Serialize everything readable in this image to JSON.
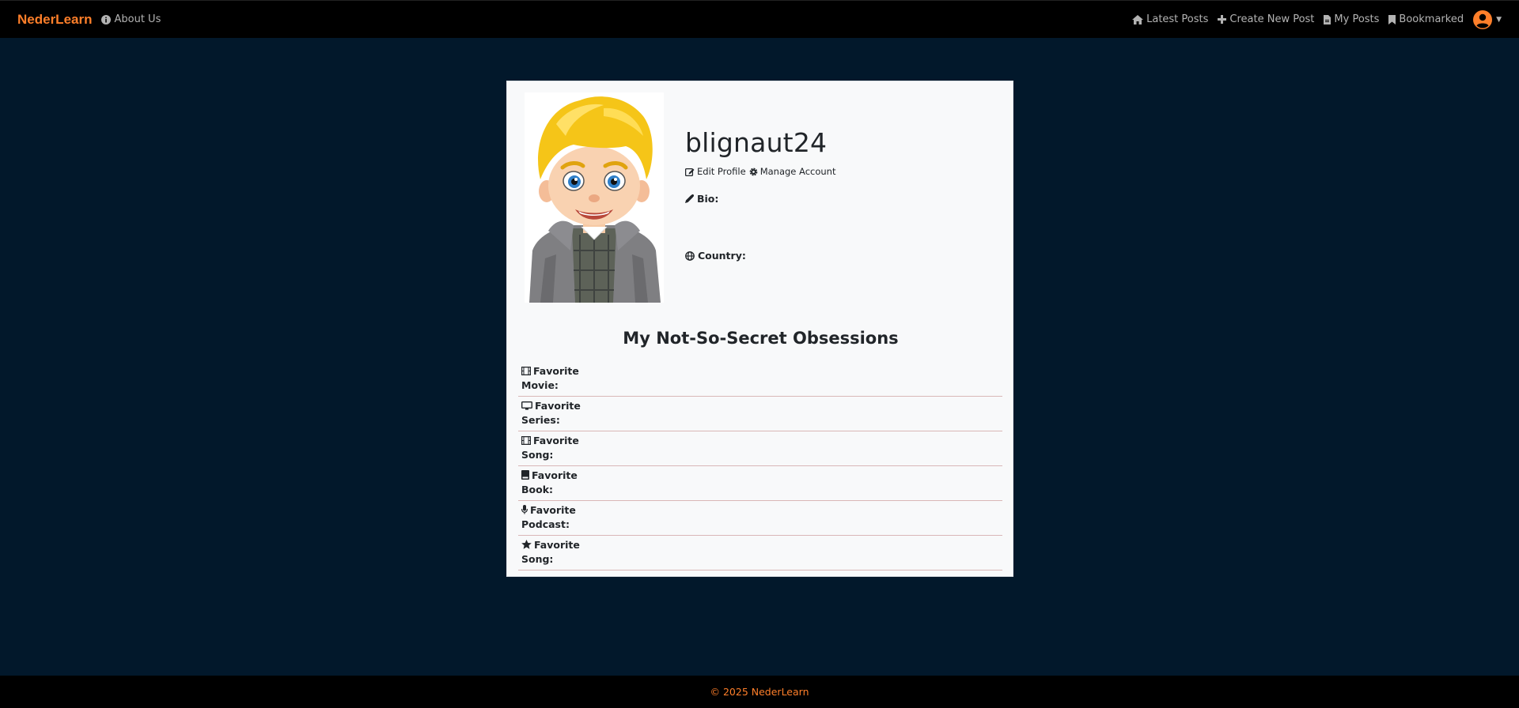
{
  "navbar": {
    "brand": "NederLearn",
    "about": "About Us",
    "links": {
      "latest": "Latest Posts",
      "create": "Create New Post",
      "my_posts": "My Posts",
      "bookmarked": "Bookmarked"
    },
    "icons": {
      "about": "info-circle-icon",
      "latest": "home-icon",
      "create": "plus-icon",
      "my_posts": "file-icon",
      "bookmarked": "bookmark-icon",
      "user": "user-circle-icon"
    }
  },
  "profile": {
    "username": "blignaut24",
    "edit_profile": "Edit Profile",
    "manage_account": "Manage Account",
    "bio_label": "Bio:",
    "country_label": "Country:"
  },
  "obsessions": {
    "title": "My Not-So-Secret Obsessions",
    "items": [
      {
        "label": "Favorite Movie:",
        "icon": "film-icon"
      },
      {
        "label": "Favorite Series:",
        "icon": "tv-icon"
      },
      {
        "label": "Favorite Song:",
        "icon": "film-icon"
      },
      {
        "label": "Favorite Book:",
        "icon": "book-icon"
      },
      {
        "label": "Favorite Podcast:",
        "icon": "microphone-icon"
      },
      {
        "label": "Favorite Song:",
        "icon": "star-icon"
      }
    ]
  },
  "footer": {
    "copyright": "© 2025 NederLearn"
  },
  "colors": {
    "accent": "#ff7f2a",
    "background": "#02182b",
    "navbar": "#000000",
    "card": "#f8f9fa"
  }
}
